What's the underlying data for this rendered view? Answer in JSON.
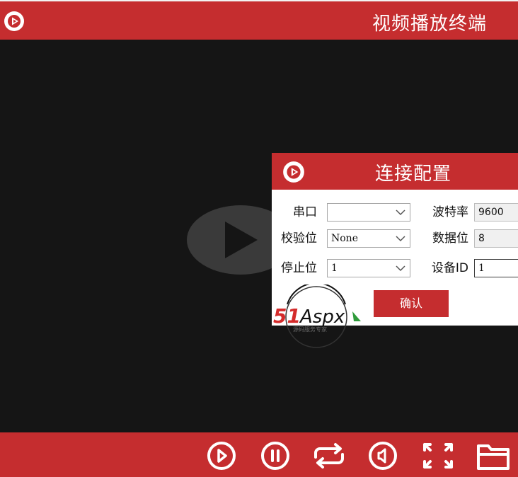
{
  "app": {
    "title": "视频播放终端",
    "accent": "#c52d2f",
    "background": "#151515"
  },
  "player": {
    "center_icon": "play-icon"
  },
  "controls": [
    {
      "name": "play",
      "icon": "play-circle-icon"
    },
    {
      "name": "pause",
      "icon": "pause-circle-icon"
    },
    {
      "name": "loop",
      "icon": "repeat-icon"
    },
    {
      "name": "volume",
      "icon": "volume-icon"
    },
    {
      "name": "fullscreen",
      "icon": "fullscreen-icon"
    },
    {
      "name": "open-file",
      "icon": "folder-icon"
    }
  ],
  "dialog": {
    "title": "连接配置",
    "fields": {
      "serial_port": {
        "label": "串口",
        "value": ""
      },
      "baud_rate": {
        "label": "波特率",
        "value": "9600"
      },
      "parity": {
        "label": "校验位",
        "value": "None"
      },
      "data_bits": {
        "label": "数据位",
        "value": "8"
      },
      "stop_bits": {
        "label": "停止位",
        "value": "1"
      },
      "device_id": {
        "label": "设备ID",
        "value": "1"
      }
    },
    "confirm_label": "确认"
  },
  "watermark": {
    "brand": "51Aspx",
    "tagline": "源码服务专家"
  }
}
